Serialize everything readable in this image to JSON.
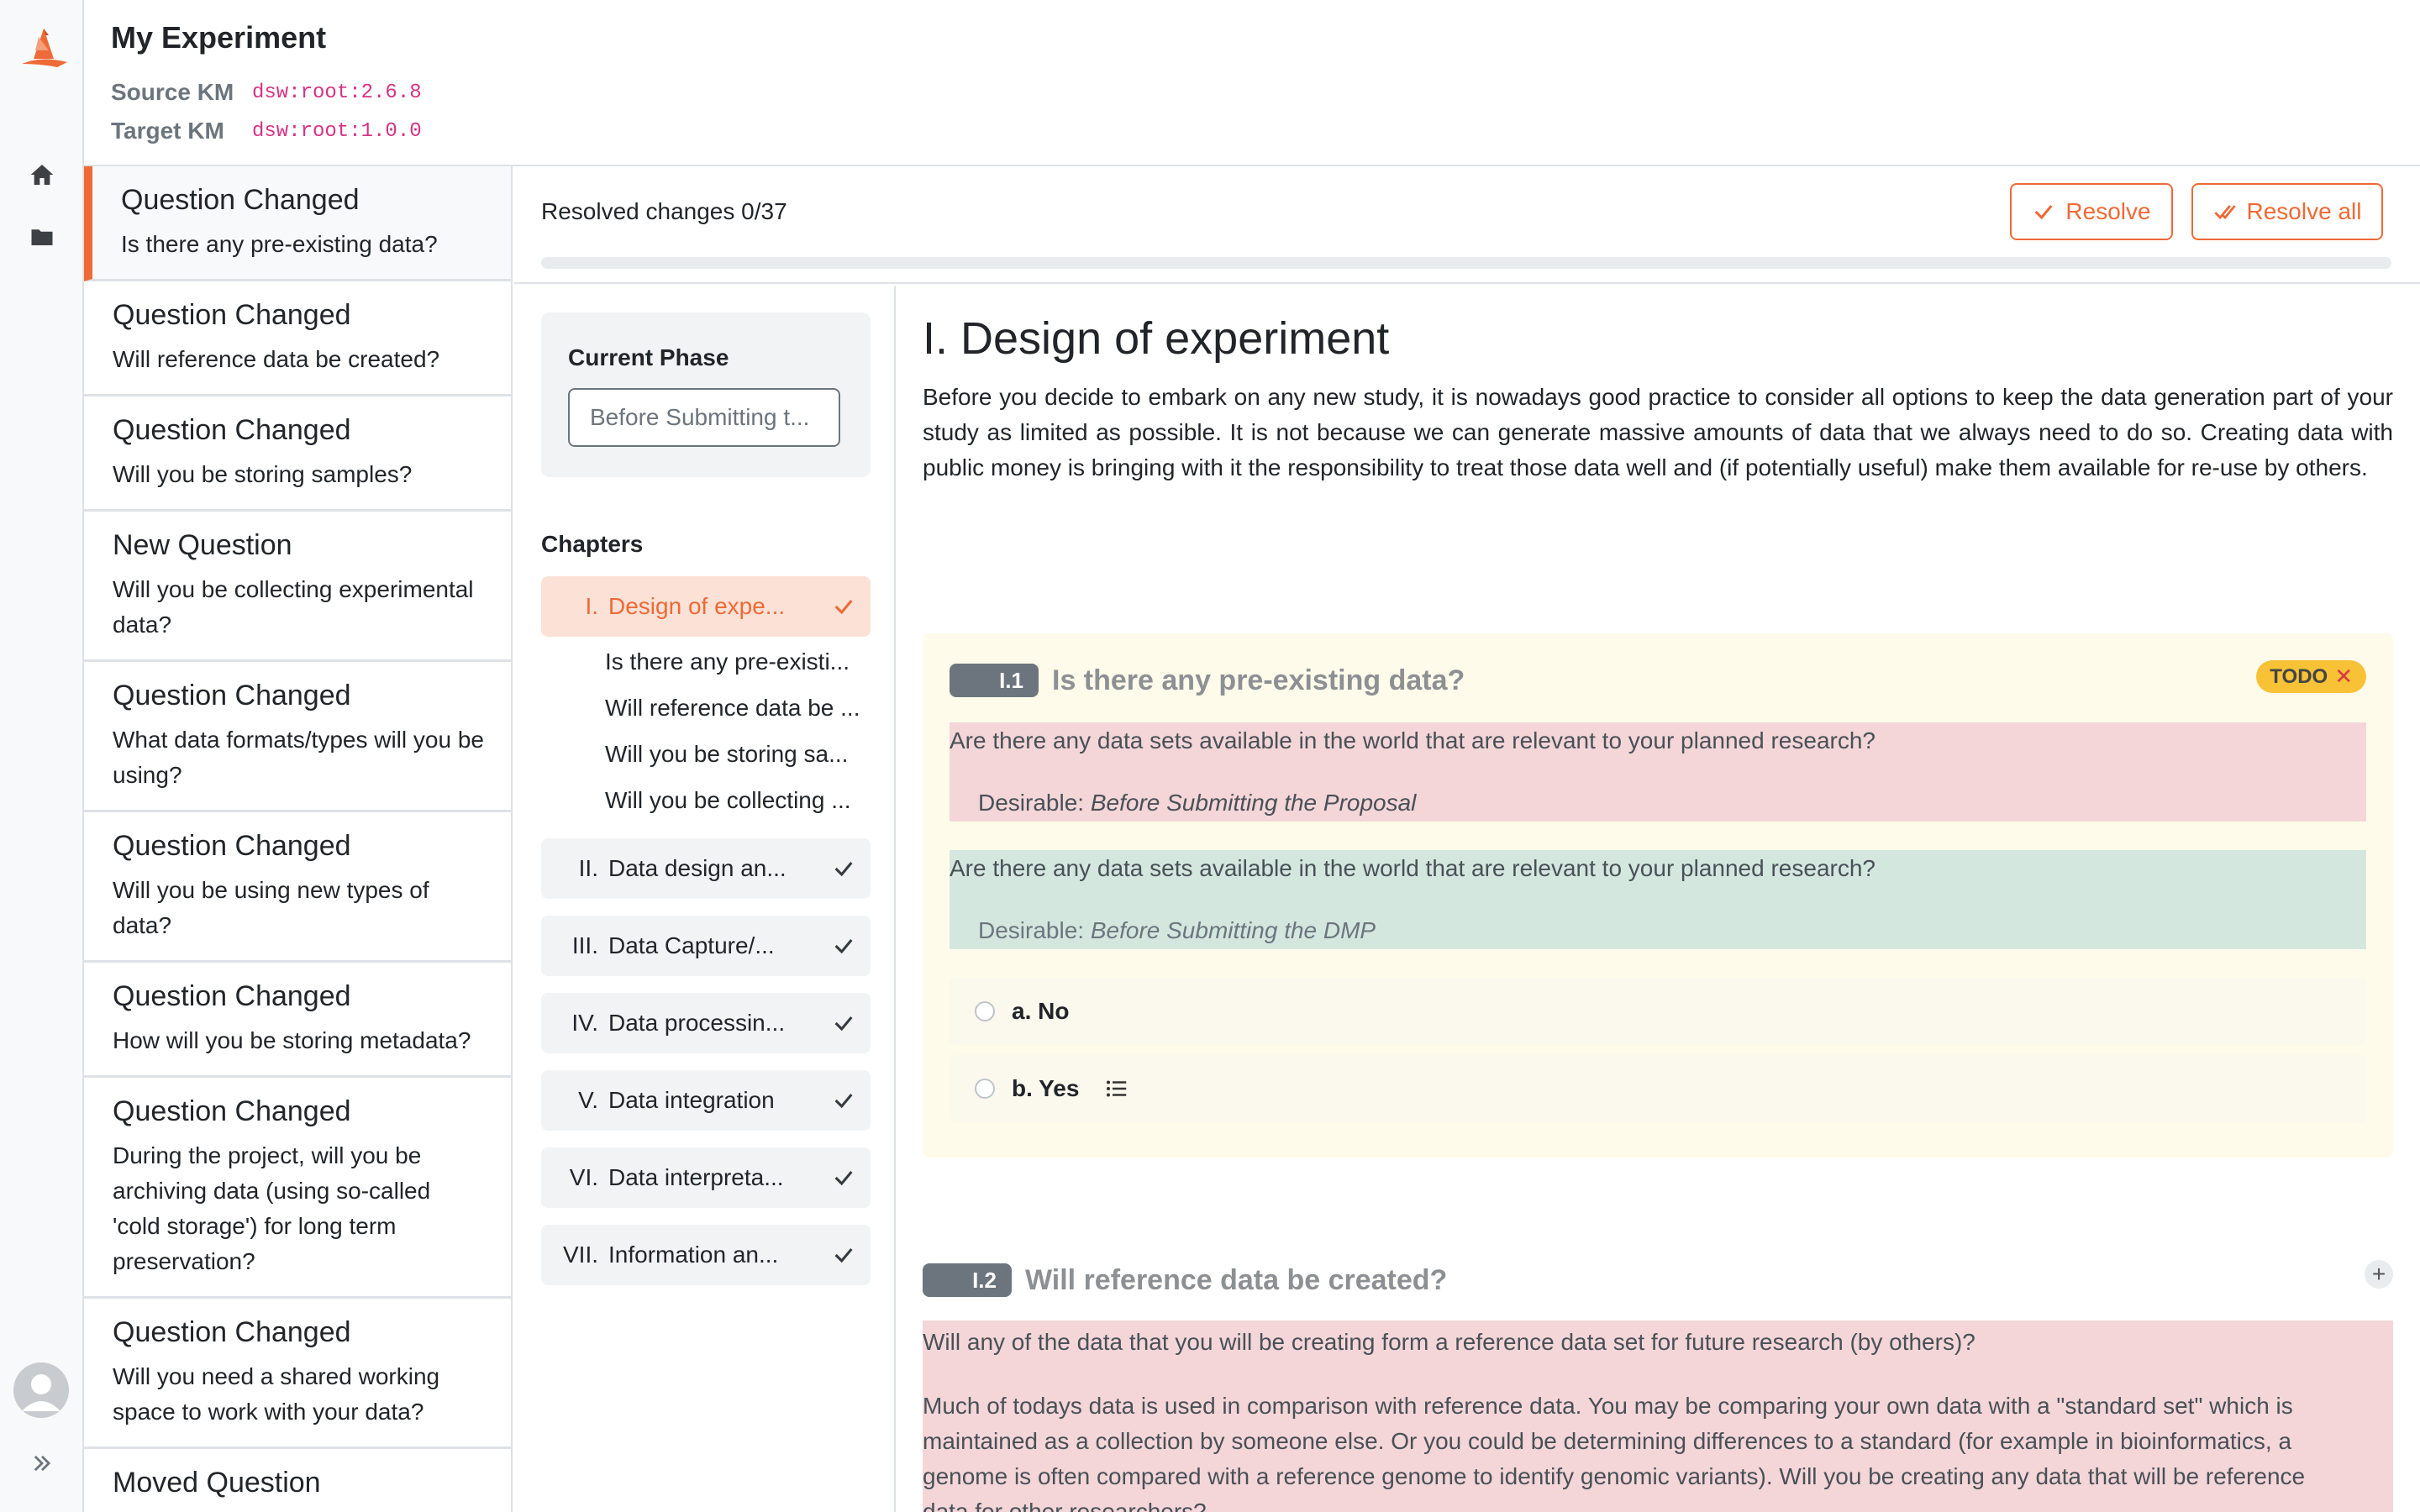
{
  "app": {
    "title": "My Experiment",
    "source_km_label": "Source KM",
    "source_km_value": "dsw:root:2.6.8",
    "target_km_label": "Target KM",
    "target_km_value": "dsw:root:1.0.0",
    "accent_color": "#ee6a36"
  },
  "sidebar_icons": [
    "logo-icon",
    "home-icon",
    "folder-icon",
    "avatar",
    "double-chevron-right-icon"
  ],
  "changes": [
    {
      "type": "Question Changed",
      "text": "Is there any pre-existing data?"
    },
    {
      "type": "Question Changed",
      "text": "Will reference data be created?"
    },
    {
      "type": "Question Changed",
      "text": "Will you be storing samples?"
    },
    {
      "type": "New Question",
      "text": "Will you be collecting experimental data?"
    },
    {
      "type": "Question Changed",
      "text": "What data formats/types will you be using?"
    },
    {
      "type": "Question Changed",
      "text": "Will you be using new types of data?"
    },
    {
      "type": "Question Changed",
      "text": "How will you be storing metadata?"
    },
    {
      "type": "Question Changed",
      "text": "During the project, will you be archiving data (using so-called 'cold storage') for long term preservation?"
    },
    {
      "type": "Question Changed",
      "text": "Will you need a shared working space to work with your data?"
    },
    {
      "type": "Moved Question",
      "text": ""
    }
  ],
  "resolved": {
    "text": "Resolved changes 0/37",
    "progress_fraction": 0,
    "resolve_label": "Resolve",
    "resolve_all_label": "Resolve all"
  },
  "phase": {
    "label": "Current Phase",
    "value": "Before Submitting t..."
  },
  "chapters_heading": "Chapters",
  "chapters": [
    {
      "num": "I.",
      "title": "Design of expe..."
    },
    {
      "num": "II.",
      "title": "Data design an..."
    },
    {
      "num": "III.",
      "title": "Data Capture/..."
    },
    {
      "num": "IV.",
      "title": "Data processin..."
    },
    {
      "num": "V.",
      "title": "Data integration"
    },
    {
      "num": "VI.",
      "title": "Data interpreta..."
    },
    {
      "num": "VII.",
      "title": "Information an..."
    }
  ],
  "subquestions": [
    "Is there any pre-existi...",
    "Will reference data be ...",
    "Will you be storing sa...",
    "Will you be collecting ..."
  ],
  "main": {
    "heading": "I. Design of experiment",
    "intro": "Before you decide to embark on any new study, it is nowadays good practice to consider all options to keep the data generation part of your study as limited as possible. It is not because we can generate massive amounts of data that we always need to do so. Creating data with public money is bringing with it the responsibility to treat those data well and (if potentially useful) make them available for re-use by others.",
    "q1": {
      "badge": "I.1",
      "title": "Is there any pre-existing data?",
      "todo": "TODO",
      "old_text": "Are there any data sets available in the world that are relevant to your planned research?",
      "old_desirable_label": "Desirable:",
      "old_desirable_value": "Before Submitting the Proposal",
      "new_text": "Are there any data sets available in the world that are relevant to your planned research?",
      "new_desirable_label": "Desirable:",
      "new_desirable_value": "Before Submitting the DMP",
      "answers": [
        "a. No",
        "b. Yes"
      ]
    },
    "q2": {
      "badge": "I.2",
      "title": "Will reference data be created?",
      "old_text": "Will any of the data that you will be creating form a reference data set for future research (by others)?",
      "old_desc_lines": [
        "Much of todays data is used in comparison with reference data. You may be comparing your own data with a \"standard set\" which is",
        "maintained as a collection by someone else. Or you could be determining differences to a standard (for example in bioinformatics, a",
        "genome is often compared with a reference genome to identify genomic variants). Will you be creating any data that will be reference",
        "data for other researchers?"
      ]
    }
  }
}
